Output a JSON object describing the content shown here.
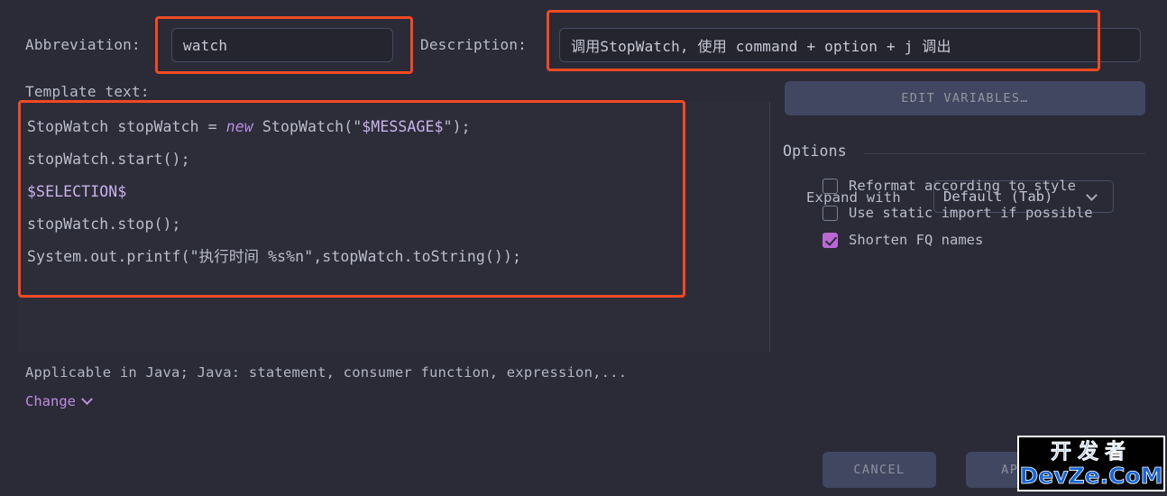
{
  "form": {
    "abbreviation_label": "Abbreviation:",
    "abbreviation_value": "watch",
    "description_label": "Description:",
    "description_value": "调用StopWatch, 使用 command + option + j 调出",
    "template_label": "Template text:"
  },
  "editor": {
    "lines": [
      [
        {
          "t": "StopWatch stopWatch = ",
          "c": "plain"
        },
        {
          "t": "new",
          "c": "kw"
        },
        {
          "t": " StopWatch(\"",
          "c": "plain"
        },
        {
          "t": "$MESSAGE$",
          "c": "var"
        },
        {
          "t": "\");",
          "c": "plain"
        }
      ],
      [
        {
          "t": "stopWatch.start();",
          "c": "plain"
        }
      ],
      [
        {
          "t": "$SELECTION$",
          "c": "var"
        }
      ],
      [
        {
          "t": "stopWatch.stop();",
          "c": "plain"
        }
      ],
      [
        {
          "t": "System.out.printf(\"执行时间 %s%n\",stopWatch.toString());",
          "c": "plain"
        }
      ]
    ]
  },
  "footer": {
    "applicable_text": "Applicable in Java; Java: statement, consumer function, expression,...",
    "change_label": "Change"
  },
  "panel": {
    "edit_variables_label": "EDIT VARIABLES…",
    "options_title": "Options",
    "expand_with_label": "Expand with",
    "expand_with_value": "Default (Tab)",
    "expand_with_options": [
      "Default (Tab)"
    ],
    "checkboxes": [
      {
        "label": "Reformat according to style",
        "checked": false
      },
      {
        "label": "Use static import if possible",
        "checked": false
      },
      {
        "label": "Shorten FQ names",
        "checked": true
      }
    ]
  },
  "actions": {
    "cancel_label": "CANCEL",
    "apply_label": "APPLY"
  },
  "watermark": {
    "line1": "开发者",
    "line2": "DevZe.CoM"
  },
  "colors": {
    "background": "#2b2b38",
    "annotation": "#f04a23",
    "accent_purple": "#b968d6",
    "scrollbar": "#b06fc9",
    "watermark_blue": "#1565d8"
  }
}
